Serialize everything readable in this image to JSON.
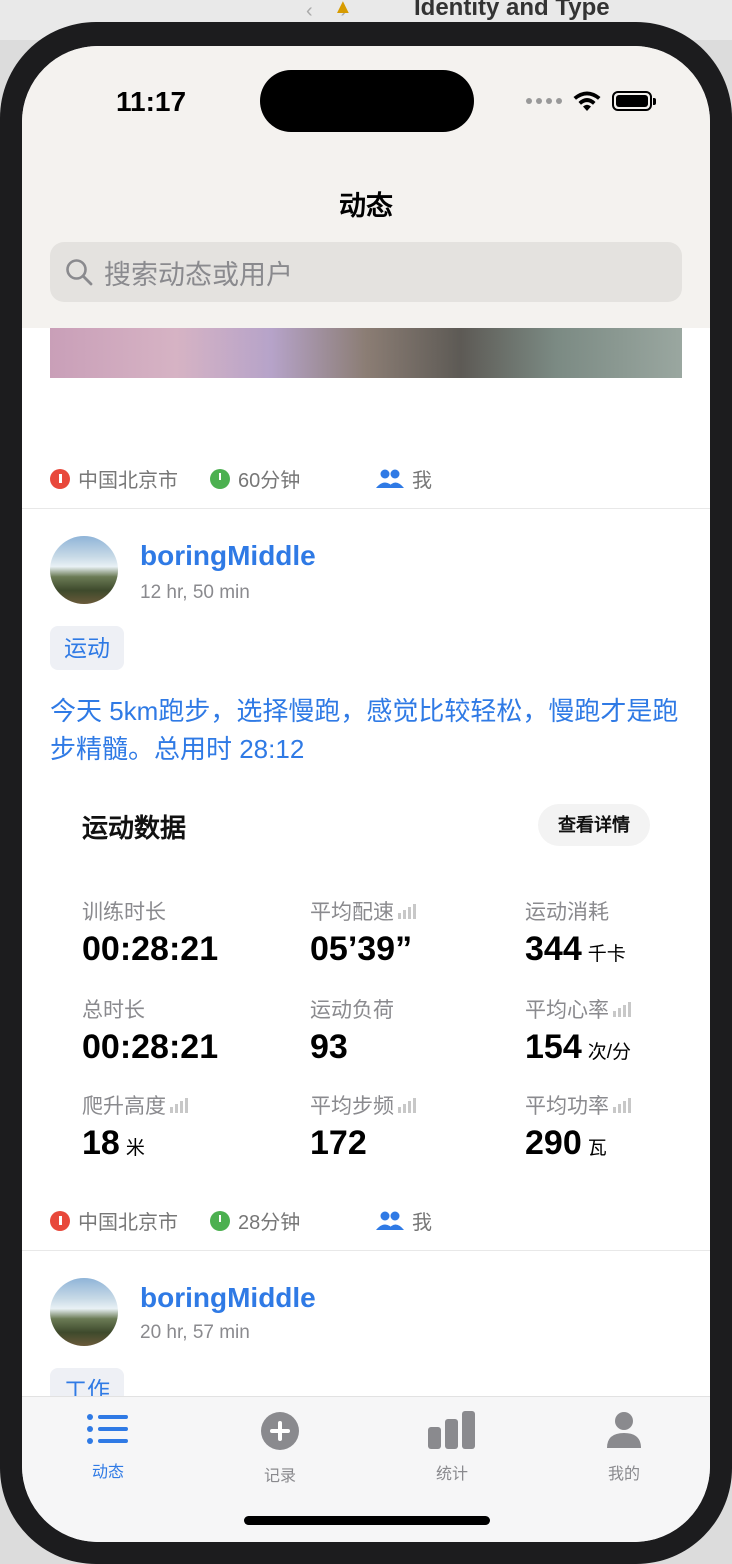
{
  "desktop": {
    "window_title": "Identity and Type"
  },
  "status_bar": {
    "time": "11:17"
  },
  "nav": {
    "title": "动态"
  },
  "search": {
    "placeholder": "搜索动态或用户"
  },
  "post0_meta": {
    "location": "中国北京市",
    "duration": "60分钟",
    "visibility": "我"
  },
  "post1": {
    "username": "boringMiddle",
    "time_ago": "12 hr, 50 min",
    "tag": "运动",
    "text": "今天 5km跑步，选择慢跑，感觉比较轻松，慢跑才是跑步精髓。总用时 28:12",
    "sport_title": "运动数据",
    "detail_label": "查看详情",
    "stats": [
      {
        "label": "训练时长",
        "value": "00:28:21",
        "unit": ""
      },
      {
        "label": "平均配速",
        "value": "05’39”",
        "unit": ""
      },
      {
        "label": "运动消耗",
        "value": "344",
        "unit": "千卡"
      },
      {
        "label": "总时长",
        "value": "00:28:21",
        "unit": ""
      },
      {
        "label": "运动负荷",
        "value": "93",
        "unit": ""
      },
      {
        "label": "平均心率",
        "value": "154",
        "unit": "次/分"
      },
      {
        "label": "爬升高度",
        "value": "18",
        "unit": "米"
      },
      {
        "label": "平均步频",
        "value": "172",
        "unit": ""
      },
      {
        "label": "平均功率",
        "value": "290",
        "unit": "瓦"
      }
    ],
    "meta": {
      "location": "中国北京市",
      "duration": "28分钟",
      "visibility": "我"
    }
  },
  "post2": {
    "username": "boringMiddle",
    "time_ago": "20 hr, 57 min",
    "tag": "工作"
  },
  "tabbar": {
    "tabs": [
      {
        "label": "动态",
        "icon": "list-icon"
      },
      {
        "label": "记录",
        "icon": "plus-circle-icon"
      },
      {
        "label": "统计",
        "icon": "bar-chart-icon"
      },
      {
        "label": "我的",
        "icon": "person-icon"
      }
    ]
  },
  "colors": {
    "accent": "#2f7ae5",
    "location": "#e8483b",
    "duration": "#4cb050"
  }
}
